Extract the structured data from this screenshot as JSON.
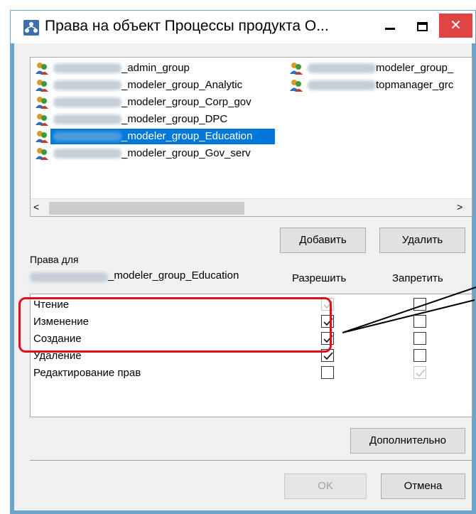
{
  "window": {
    "title": "Права на объект Процессы продукта О...",
    "close_glyph": "✕"
  },
  "groups": [
    {
      "label": "_admin_group",
      "selected": false
    },
    {
      "label": "_modeler_group_Analytic",
      "selected": false
    },
    {
      "label": "_modeler_group_Corp_gov",
      "selected": false
    },
    {
      "label": "_modeler_group_DPC",
      "selected": false
    },
    {
      "label": "_modeler_group_Education",
      "selected": true
    },
    {
      "label": "_modeler_group_Gov_serv",
      "selected": false
    },
    {
      "label": "modeler_group_",
      "selected": false
    },
    {
      "label": "topmanager_grc",
      "selected": false
    }
  ],
  "scroll": {
    "left_arrow": "<",
    "right_arrow": ">"
  },
  "buttons": {
    "add": "Добавить",
    "remove": "Удалить",
    "advanced": "Дополнительно",
    "ok": "OK",
    "cancel": "Отмена"
  },
  "rights": {
    "for_label": "Права для",
    "group_name": "_modeler_group_Education",
    "col_allow": "Разрешить",
    "col_deny": "Запретить",
    "items": [
      {
        "label": "Чтение",
        "allow": true,
        "allow_disabled": true,
        "deny": false,
        "deny_disabled": false
      },
      {
        "label": "Изменение",
        "allow": true,
        "allow_disabled": false,
        "deny": false,
        "deny_disabled": false
      },
      {
        "label": "Создание",
        "allow": true,
        "allow_disabled": false,
        "deny": false,
        "deny_disabled": false
      },
      {
        "label": "Удаление",
        "allow": true,
        "allow_disabled": false,
        "deny": false,
        "deny_disabled": false
      },
      {
        "label": "Редактирование прав",
        "allow": false,
        "allow_disabled": false,
        "deny": true,
        "deny_disabled": true
      }
    ]
  },
  "colors": {
    "selection": "#0078d7",
    "annotation": "#e0101a",
    "close": "#e04343"
  }
}
